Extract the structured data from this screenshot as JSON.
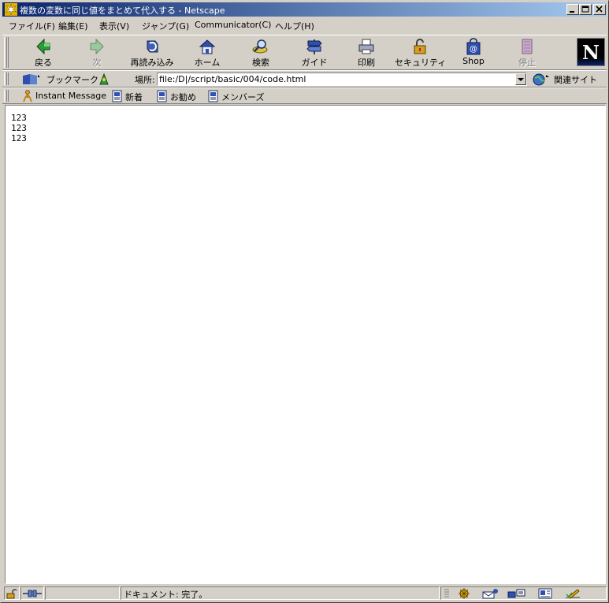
{
  "window": {
    "title": "複数の変数に同じ値をまとめて代入する - Netscape"
  },
  "menubar": {
    "items": [
      "ファイル(F)",
      "編集(E)",
      "表示(V)",
      "ジャンプ(G)",
      "Communicator(C)",
      "ヘルプ(H)"
    ]
  },
  "toolbar": {
    "buttons": [
      "戻る",
      "次",
      "再読み込み",
      "ホーム",
      "検索",
      "ガイド",
      "印刷",
      "セキュリティ",
      "Shop",
      "停止"
    ]
  },
  "location": {
    "bookmarks_label": "ブックマーク",
    "location_label": "場所:",
    "url": "file:/D|/script/basic/004/code.html",
    "related_label": "関連サイト"
  },
  "personal_toolbar": {
    "items": [
      "Instant Message",
      "新着",
      "お勧め",
      "メンバーズ"
    ]
  },
  "page": {
    "lines": [
      "123",
      "123",
      "123"
    ]
  },
  "status": {
    "text": "ドキュメント: 完了。"
  },
  "colors": {
    "titlebar_start": "#0a246a",
    "titlebar_end": "#a6caf0",
    "chrome": "#d4d0c8"
  }
}
